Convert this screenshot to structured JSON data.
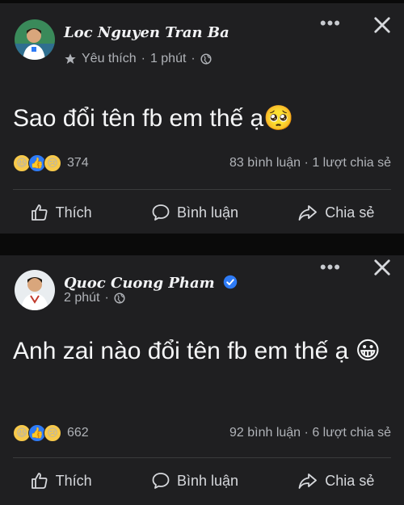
{
  "posts": [
    {
      "author": "Loc Nguyen Tran Ba",
      "meta_prefix": "Yêu thích",
      "time": "1 phút",
      "content": "Sao đổi tên fb em thế ạ",
      "content_emoji": "🥺",
      "reaction_count": "374",
      "comments": "83 bình luận",
      "shares": "1 lượt chia sẻ"
    },
    {
      "author": "Quoc Cuong Pham",
      "verified": true,
      "time": "2 phút",
      "content": "Anh zai nào đổi tên fb em thế ạ",
      "content_emoji": "😀",
      "reaction_count": "662",
      "comments": "92 bình luận",
      "shares": "6 lượt chia sẻ"
    }
  ],
  "actions": {
    "like": "Thích",
    "comment": "Bình luận",
    "share": "Chia sẻ"
  },
  "icons": {
    "more": "more-options-icon",
    "close": "close-icon",
    "globe": "globe-icon",
    "star": "star-icon",
    "verified": "verified-badge-icon"
  },
  "colors": {
    "background": "#0a0a0a",
    "card": "#1f1f21",
    "text": "#e4e6eb",
    "muted": "#b0b3b8",
    "verified": "#2e7bf6"
  },
  "separator": "·"
}
